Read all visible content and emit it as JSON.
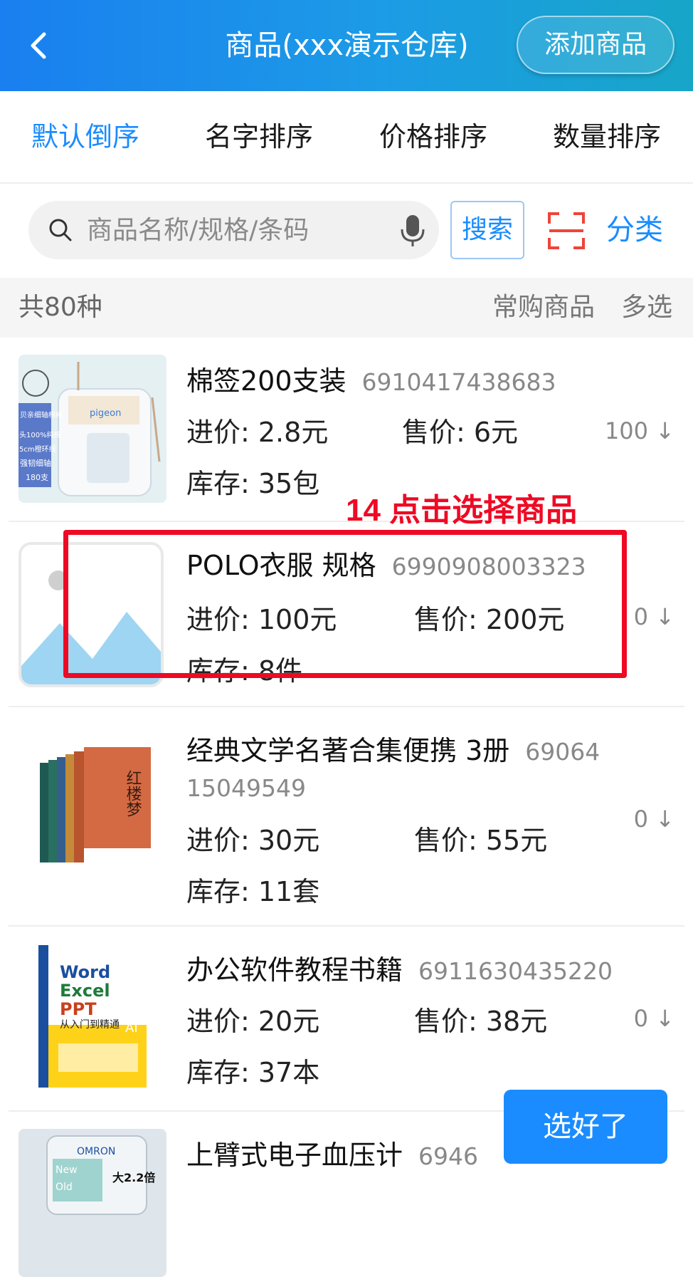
{
  "header": {
    "title": "商品(xxx演示仓库)",
    "add_button": "添加商品",
    "background": "#1a8cff"
  },
  "sort_tabs": [
    {
      "label": "默认倒序",
      "active": true
    },
    {
      "label": "名字排序",
      "active": false
    },
    {
      "label": "价格排序",
      "active": false
    },
    {
      "label": "数量排序",
      "active": false
    }
  ],
  "search": {
    "placeholder": "商品名称/规格/条码",
    "value": "",
    "button_label": "搜索",
    "category_label": "分类",
    "scan_icon": "scan-icon",
    "mic_icon": "microphone-icon"
  },
  "summary": {
    "count_text": "共80种",
    "frequent_label": "常购商品",
    "multi_select_label": "多选"
  },
  "products": [
    {
      "name": "棉签200支装",
      "barcode": "6910417438683",
      "cost": "进价: 2.8元",
      "price": "售价: 6元",
      "stock": "库存: 35包",
      "qty": "100 ↓",
      "image_text": {
        "badge": "贝亲细轴棉棒",
        "line1": "头100%纯棉",
        "line2": "5cm橙环线",
        "line3": "强韧细轴",
        "line4": "180支",
        "brand": "pigeon"
      }
    },
    {
      "name": "POLO衣服  规格",
      "barcode": "6990908003323",
      "cost": "进价: 100元",
      "price": "售价: 200元",
      "stock": "库存: 8件",
      "qty": "0 ↓"
    },
    {
      "name": "经典文学名著合集便携  3册",
      "barcode_part1": "69064",
      "barcode_part2": "15049549",
      "cost": "进价: 30元",
      "price": "售价: 55元",
      "stock": "库存: 11套",
      "qty": "0 ↓",
      "image_text": {
        "cover": "红楼梦"
      }
    },
    {
      "name": "办公软件教程书籍",
      "barcode": "6911630435220",
      "cost": "进价: 20元",
      "price": "售价: 38元",
      "stock": "库存: 37本",
      "qty": "0 ↓",
      "image_text": {
        "line1": "Word",
        "line2": "Excel",
        "line3": "PPT",
        "line4": "从入门到精通",
        "tag": "AI"
      }
    },
    {
      "name": "上臂式电子血压计",
      "barcode": "6946",
      "image_text": {
        "brand": "OMRON",
        "badge": "大2.2倍",
        "new": "New",
        "old": "Old"
      }
    }
  ],
  "annotation": {
    "text": "14 点击选择商品",
    "color": "#ee0a24"
  },
  "done_button": "选好了",
  "colors": {
    "accent": "#1a8cff",
    "annotation": "#ee0a24",
    "scan": "#f04438"
  }
}
